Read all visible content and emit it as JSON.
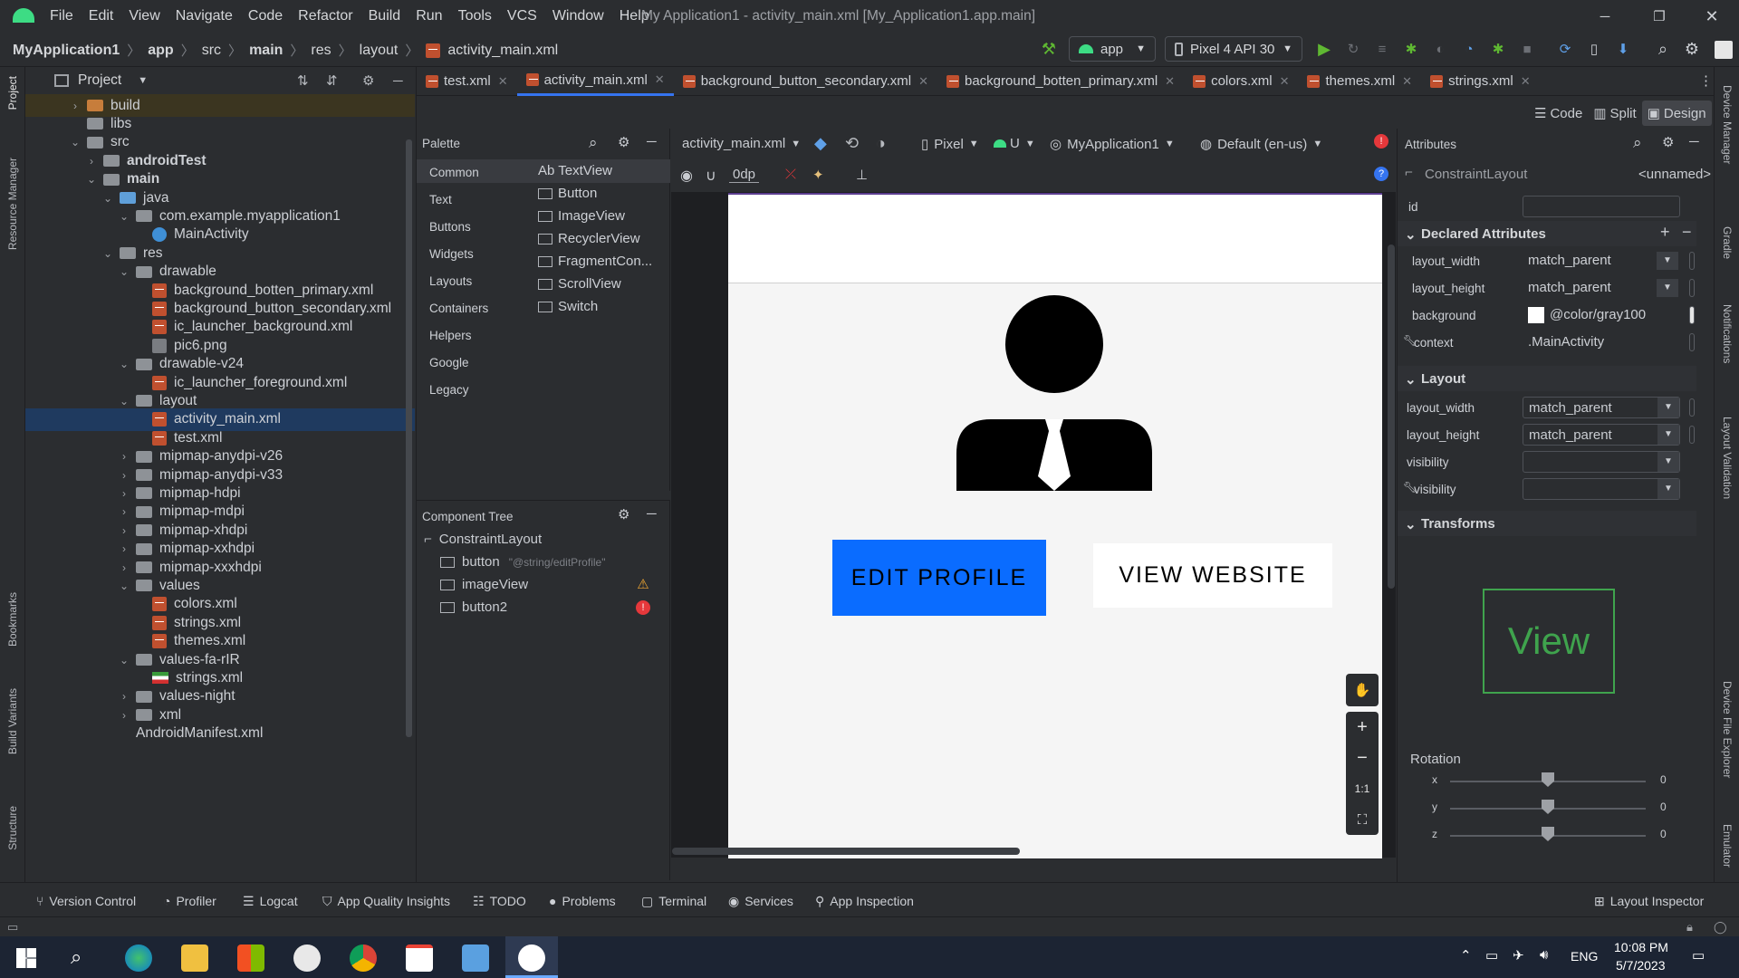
{
  "menu": [
    "File",
    "Edit",
    "View",
    "Navigate",
    "Code",
    "Refactor",
    "Build",
    "Run",
    "Tools",
    "VCS",
    "Window",
    "Help"
  ],
  "window_title": "My Application1 - activity_main.xml [My_Application1.app.main]",
  "breadcrumbs": [
    "MyApplication1",
    "app",
    "src",
    "main",
    "res",
    "layout",
    "activity_main.xml"
  ],
  "run_config": "app",
  "device_selector": "Pixel 4 API 30",
  "project_panel": {
    "title": "Project",
    "items": [
      {
        "label": "build",
        "level": 2,
        "arrow": "right",
        "icon": "folder-orange",
        "hl": true
      },
      {
        "label": "libs",
        "level": 2,
        "arrow": "",
        "icon": "folder"
      },
      {
        "label": "src",
        "level": 2,
        "arrow": "down",
        "icon": "folder"
      },
      {
        "label": "androidTest",
        "level": 3,
        "arrow": "right",
        "icon": "folder",
        "bold": true
      },
      {
        "label": "main",
        "level": 3,
        "arrow": "down",
        "icon": "folder",
        "bold": true
      },
      {
        "label": "java",
        "level": 4,
        "arrow": "down",
        "icon": "folder-blue"
      },
      {
        "label": "com.example.myapplication1",
        "level": 5,
        "arrow": "down",
        "icon": "folder"
      },
      {
        "label": "MainActivity",
        "level": 6,
        "arrow": "",
        "icon": "class"
      },
      {
        "label": "res",
        "level": 4,
        "arrow": "down",
        "icon": "folder"
      },
      {
        "label": "drawable",
        "level": 5,
        "arrow": "down",
        "icon": "folder"
      },
      {
        "label": "background_botten_primary.xml",
        "level": 6,
        "arrow": "",
        "icon": "xml"
      },
      {
        "label": "background_button_secondary.xml",
        "level": 6,
        "arrow": "",
        "icon": "xml"
      },
      {
        "label": "ic_launcher_background.xml",
        "level": 6,
        "arrow": "",
        "icon": "xml"
      },
      {
        "label": "pic6.png",
        "level": 6,
        "arrow": "",
        "icon": "png"
      },
      {
        "label": "drawable-v24",
        "level": 5,
        "arrow": "down",
        "icon": "folder"
      },
      {
        "label": "ic_launcher_foreground.xml",
        "level": 6,
        "arrow": "",
        "icon": "xml"
      },
      {
        "label": "layout",
        "level": 5,
        "arrow": "down",
        "icon": "folder"
      },
      {
        "label": "activity_main.xml",
        "level": 6,
        "arrow": "",
        "icon": "xml",
        "sel": true
      },
      {
        "label": "test.xml",
        "level": 6,
        "arrow": "",
        "icon": "xml"
      },
      {
        "label": "mipmap-anydpi-v26",
        "level": 5,
        "arrow": "right",
        "icon": "folder"
      },
      {
        "label": "mipmap-anydpi-v33",
        "level": 5,
        "arrow": "right",
        "icon": "folder"
      },
      {
        "label": "mipmap-hdpi",
        "level": 5,
        "arrow": "right",
        "icon": "folder"
      },
      {
        "label": "mipmap-mdpi",
        "level": 5,
        "arrow": "right",
        "icon": "folder"
      },
      {
        "label": "mipmap-xhdpi",
        "level": 5,
        "arrow": "right",
        "icon": "folder"
      },
      {
        "label": "mipmap-xxhdpi",
        "level": 5,
        "arrow": "right",
        "icon": "folder"
      },
      {
        "label": "mipmap-xxxhdpi",
        "level": 5,
        "arrow": "right",
        "icon": "folder"
      },
      {
        "label": "values",
        "level": 5,
        "arrow": "down",
        "icon": "folder"
      },
      {
        "label": "colors.xml",
        "level": 6,
        "arrow": "",
        "icon": "xml"
      },
      {
        "label": "strings.xml",
        "level": 6,
        "arrow": "",
        "icon": "xml"
      },
      {
        "label": "themes.xml",
        "level": 6,
        "arrow": "",
        "icon": "xml"
      },
      {
        "label": "values-fa-rIR",
        "level": 5,
        "arrow": "down",
        "icon": "folder"
      },
      {
        "label": "strings.xml",
        "level": 6,
        "arrow": "",
        "icon": "flag"
      },
      {
        "label": "values-night",
        "level": 5,
        "arrow": "right",
        "icon": "folder"
      },
      {
        "label": "xml",
        "level": 5,
        "arrow": "right",
        "icon": "folder"
      },
      {
        "label": "AndroidManifest.xml",
        "level": 5,
        "arrow": "",
        "icon": "none"
      }
    ]
  },
  "editor_tabs": [
    {
      "label": "test.xml"
    },
    {
      "label": "activity_main.xml",
      "active": true
    },
    {
      "label": "background_button_secondary.xml"
    },
    {
      "label": "background_botten_primary.xml"
    },
    {
      "label": "colors.xml"
    },
    {
      "label": "themes.xml"
    },
    {
      "label": "strings.xml"
    }
  ],
  "view_modes": {
    "code": "Code",
    "split": "Split",
    "design": "Design"
  },
  "palette": {
    "title": "Palette",
    "categories": [
      "Common",
      "Text",
      "Buttons",
      "Widgets",
      "Layouts",
      "Containers",
      "Helpers",
      "Google",
      "Legacy"
    ],
    "items": [
      "Ab TextView",
      "Button",
      "ImageView",
      "RecyclerView",
      "FragmentCon...",
      "ScrollView",
      "Switch"
    ]
  },
  "component_tree": {
    "title": "Component Tree",
    "root": "ConstraintLayout",
    "children": [
      {
        "label": "button",
        "hint": "\"@string/editProfile\"",
        "status": ""
      },
      {
        "label": "imageView",
        "hint": "",
        "status": "warning"
      },
      {
        "label": "button2",
        "hint": "",
        "status": "error"
      }
    ]
  },
  "design_toolbar": {
    "file": "activity_main.xml",
    "device": "Pixel",
    "api": "U",
    "theme": "MyApplication1",
    "locale": "Default (en-us)",
    "margin": "0dp"
  },
  "preview": {
    "edit_button": "EDIT PROFILE",
    "view_button": "VIEW WEBSITE",
    "edit_color": "#0a6cff"
  },
  "zoom": {
    "fit": "1:1"
  },
  "attributes": {
    "title": "Attributes",
    "component": "ConstraintLayout",
    "component_id": "<unnamed>",
    "id_label": "id",
    "declared_title": "Declared Attributes",
    "declared": [
      {
        "name": "layout_width",
        "value": "match_parent"
      },
      {
        "name": "layout_height",
        "value": "match_parent"
      },
      {
        "name": "background",
        "value": "@color/gray100"
      },
      {
        "name": "context",
        "value": ".MainActivity"
      }
    ],
    "layout_title": "Layout",
    "layout": [
      {
        "name": "layout_width",
        "value": "match_parent"
      },
      {
        "name": "layout_height",
        "value": "match_parent"
      },
      {
        "name": "visibility",
        "value": ""
      },
      {
        "name": "visibility",
        "value": ""
      }
    ],
    "transforms_title": "Transforms",
    "view_label": "View",
    "rotation_title": "Rotation",
    "rotation": [
      {
        "axis": "x",
        "value": "0"
      },
      {
        "axis": "y",
        "value": "0"
      },
      {
        "axis": "z",
        "value": "0"
      }
    ]
  },
  "bottom_tools": [
    "Version Control",
    "Profiler",
    "Logcat",
    "App Quality Insights",
    "TODO",
    "Problems",
    "Terminal",
    "Services",
    "App Inspection"
  ],
  "layout_inspector": "Layout Inspector",
  "left_strip": [
    "Project",
    "Resource Manager",
    "Bookmarks",
    "Build Variants",
    "Structure"
  ],
  "right_strip": [
    "Device Manager",
    "Gradle",
    "Notifications",
    "Layout Validation",
    "Device File Explorer",
    "Emulator"
  ],
  "taskbar": {
    "time": "10:08 PM",
    "date": "5/7/2023",
    "lang": "ENG"
  }
}
